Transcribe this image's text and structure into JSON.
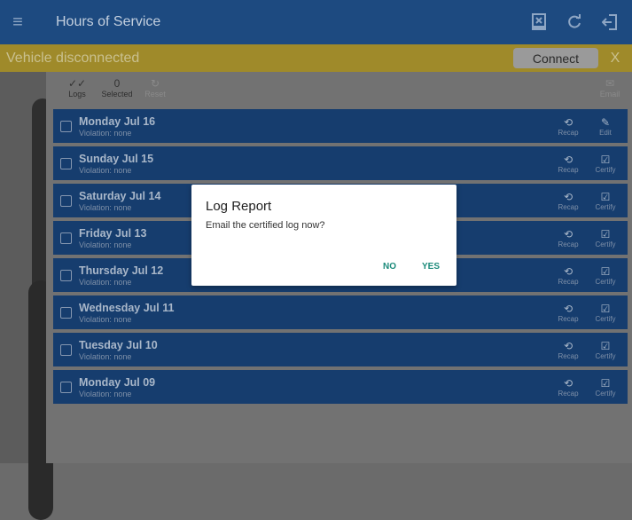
{
  "appbar": {
    "title": "Hours of Service"
  },
  "banner": {
    "text": "Vehicle disconnected",
    "connect_label": "Connect",
    "close_label": "X"
  },
  "toolbar": {
    "logs_label": "Logs",
    "selected_count": "0",
    "selected_label": "Selected",
    "reset_label": "Reset",
    "email_label": "Email"
  },
  "rows": [
    {
      "day": "Monday Jul 16",
      "violation": "Violation: none",
      "recap": "Recap",
      "action": "Edit"
    },
    {
      "day": "Sunday Jul 15",
      "violation": "Violation: none",
      "recap": "Recap",
      "action": "Certify"
    },
    {
      "day": "Saturday Jul 14",
      "violation": "Violation: none",
      "recap": "Recap",
      "action": "Certify"
    },
    {
      "day": "Friday Jul 13",
      "violation": "Violation: none",
      "recap": "Recap",
      "action": "Certify"
    },
    {
      "day": "Thursday Jul 12",
      "violation": "Violation: none",
      "recap": "Recap",
      "action": "Certify"
    },
    {
      "day": "Wednesday Jul 11",
      "violation": "Violation: none",
      "recap": "Recap",
      "action": "Certify"
    },
    {
      "day": "Tuesday Jul 10",
      "violation": "Violation: none",
      "recap": "Recap",
      "action": "Certify"
    },
    {
      "day": "Monday Jul 09",
      "violation": "Violation: none",
      "recap": "Recap",
      "action": "Certify"
    }
  ],
  "dialog": {
    "title": "Log Report",
    "message": "Email the certified log now?",
    "no_label": "NO",
    "yes_label": "YES"
  },
  "colors": {
    "appbar": "#1d4a80",
    "banner": "#9f8a2a",
    "row": "#163d6e",
    "dialog_accent": "#1b8a7a"
  },
  "icons": {
    "menu": "menu-icon",
    "report": "report-icon",
    "refresh": "refresh-icon",
    "logout": "logout-icon"
  }
}
